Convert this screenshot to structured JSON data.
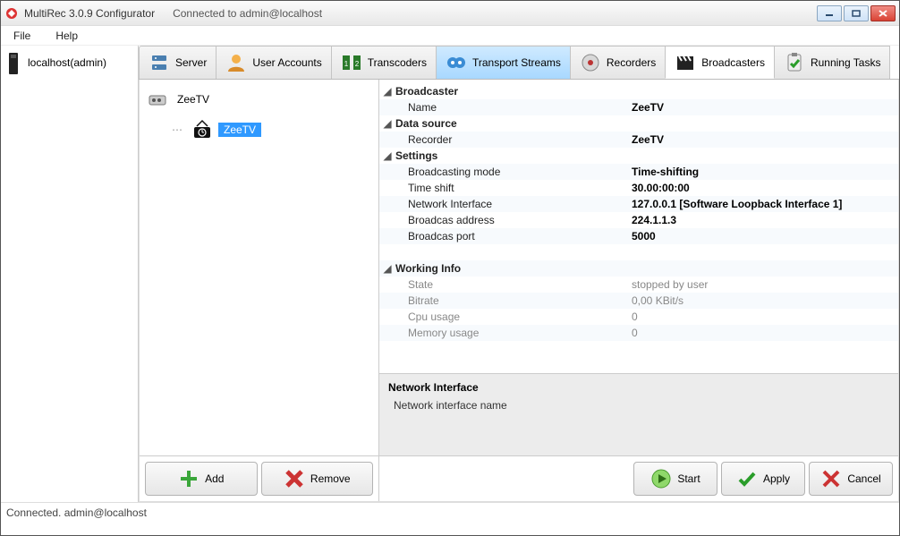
{
  "window": {
    "title": "MultiRec 3.0.9 Configurator",
    "conn": "Connected to admin@localhost"
  },
  "menu": {
    "file": "File",
    "help": "Help"
  },
  "host": {
    "label": "localhost(admin)"
  },
  "tabs": {
    "server": "Server",
    "users": "User Accounts",
    "transcoders": "Transcoders",
    "transport": "Transport Streams",
    "recorders": "Recorders",
    "broadcasters": "Broadcasters",
    "tasks": "Running Tasks"
  },
  "tree": {
    "root": "ZeeTV",
    "child": "ZeeTV"
  },
  "mid_buttons": {
    "add": "Add",
    "remove": "Remove"
  },
  "props": {
    "cat_broadcaster": "Broadcaster",
    "name_label": "Name",
    "name_val": "ZeeTV",
    "cat_datasource": "Data source",
    "recorder_label": "Recorder",
    "recorder_val": "ZeeTV",
    "cat_settings": "Settings",
    "mode_label": "Broadcasting mode",
    "mode_val": "Time-shifting",
    "shift_label": "Time shift",
    "shift_val": "30.00:00:00",
    "iface_label": "Network Interface",
    "iface_val": "127.0.0.1 [Software Loopback Interface 1]",
    "addr_label": "Broadcas address",
    "addr_val": "224.1.1.3",
    "port_label": "Broadcas port",
    "port_val": "5000",
    "cat_working": "Working Info",
    "state_label": "State",
    "state_val": "stopped by user",
    "bitrate_label": "Bitrate",
    "bitrate_val": "0,00 KBit/s",
    "cpu_label": "Cpu usage",
    "cpu_val": "0",
    "mem_label": "Memory usage",
    "mem_val": "0"
  },
  "desc": {
    "title": "Network Interface",
    "body": "Network interface name"
  },
  "right_buttons": {
    "start": "Start",
    "apply": "Apply",
    "cancel": "Cancel"
  },
  "status": "Connected. admin@localhost"
}
